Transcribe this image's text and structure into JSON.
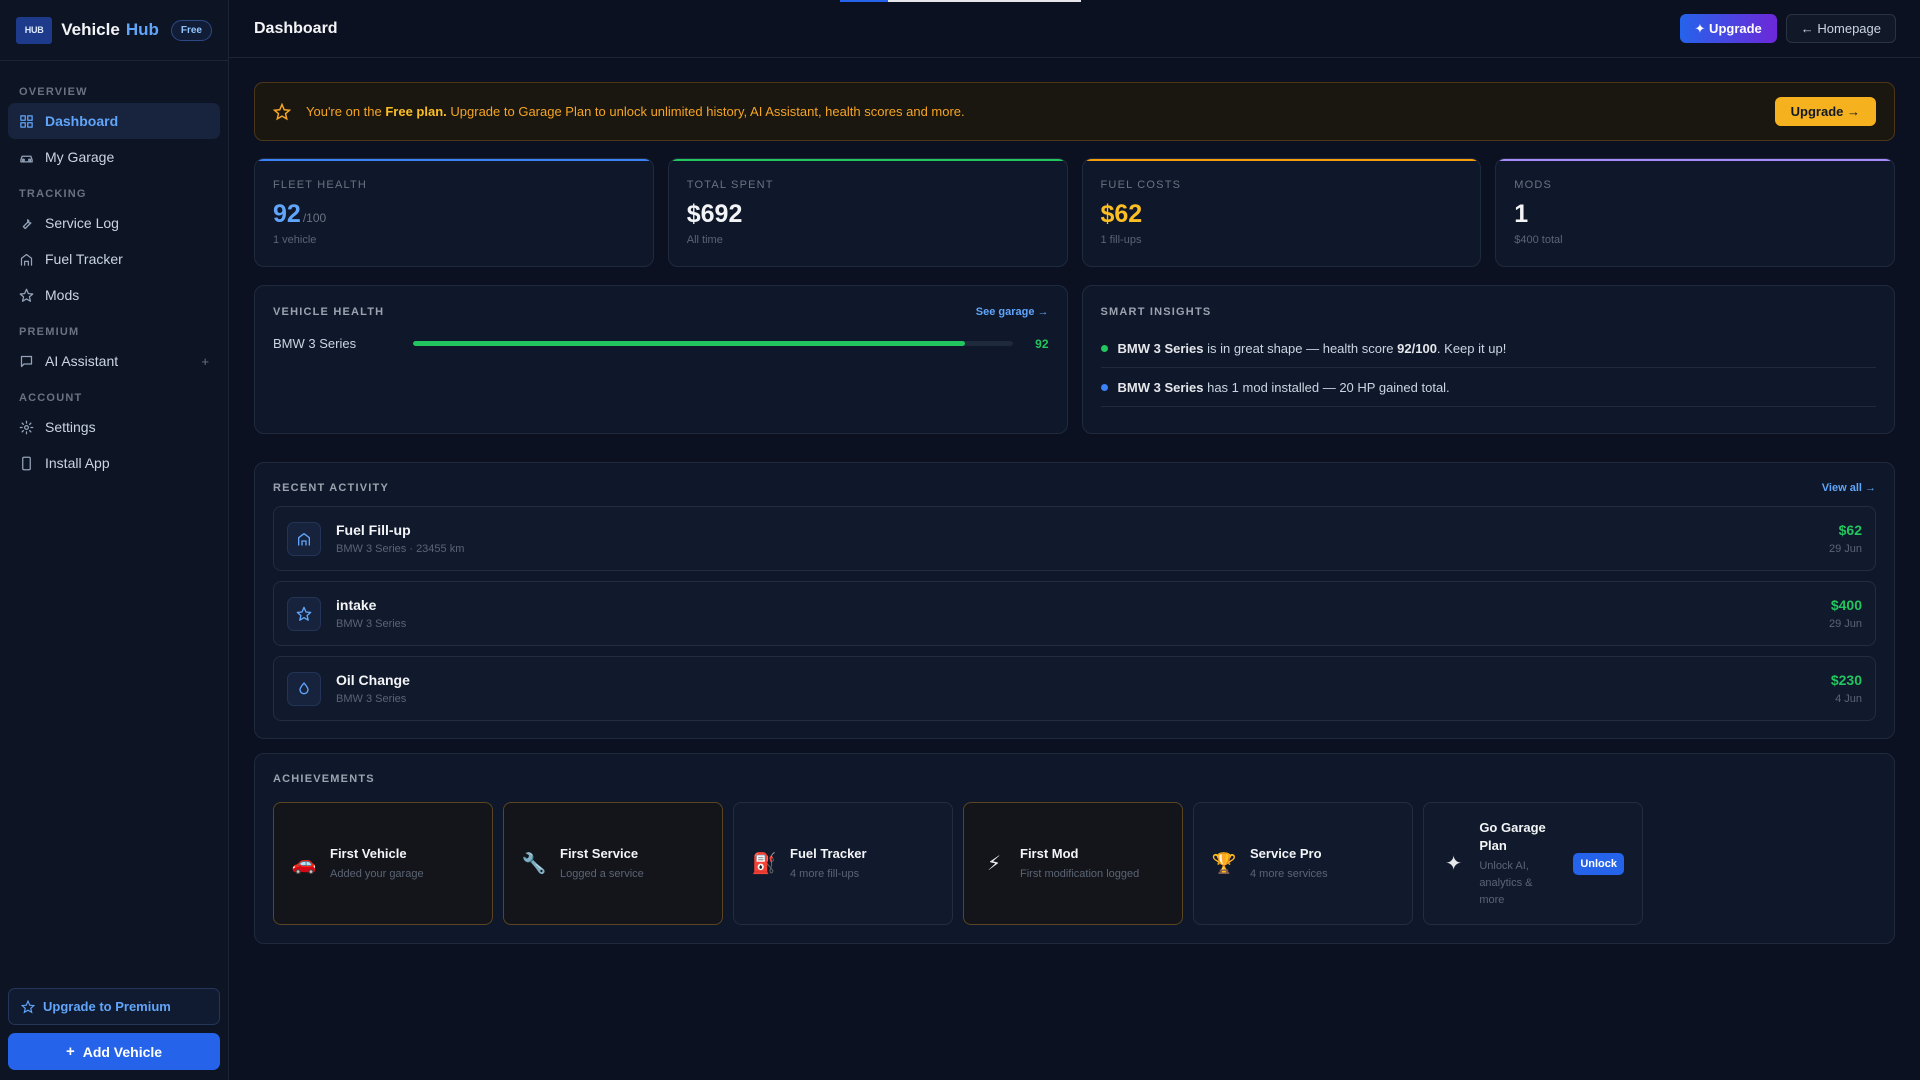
{
  "sidebar": {
    "logo_text": "HUB",
    "brand_name": "Vehicle",
    "brand_accent": "Hub",
    "plan_badge": "Free",
    "sections": [
      {
        "label": "OVERVIEW",
        "items": [
          {
            "label": "Dashboard",
            "icon": "grid-icon",
            "active": true
          },
          {
            "label": "My Garage",
            "icon": "car-icon"
          }
        ]
      },
      {
        "label": "TRACKING",
        "items": [
          {
            "label": "Service Log",
            "icon": "wrench-icon"
          },
          {
            "label": "Fuel Tracker",
            "icon": "fuel-icon"
          },
          {
            "label": "Mods",
            "icon": "star-icon"
          }
        ]
      },
      {
        "label": "PREMIUM",
        "items": [
          {
            "label": "AI Assistant",
            "icon": "chat-icon",
            "badge": "+"
          }
        ]
      },
      {
        "label": "ACCOUNT",
        "items": [
          {
            "label": "Settings",
            "icon": "gear-icon"
          },
          {
            "label": "Install App",
            "icon": "phone-icon"
          }
        ]
      }
    ],
    "upgrade_premium": "Upgrade to Premium",
    "add_vehicle": "Add Vehicle"
  },
  "header": {
    "title": "Dashboard",
    "upgrade_label": "✦ Upgrade",
    "homepage_label": "← Homepage"
  },
  "banner": {
    "prefix": "You're on the ",
    "plan": "Free plan.",
    "text": " Upgrade to Garage Plan to unlock unlimited history, AI Assistant, health scores and more.",
    "button": "Upgrade →"
  },
  "stats": [
    {
      "label": "FLEET HEALTH",
      "value": "92",
      "suffix": "/100",
      "sub": "1 vehicle",
      "accent": "#3b82f6",
      "value_color": "#60a5fa"
    },
    {
      "label": "TOTAL SPENT",
      "value": "$692",
      "suffix": "",
      "sub": "All time",
      "accent": "#22c55e",
      "value_color": "#f3f4f6"
    },
    {
      "label": "FUEL COSTS",
      "value": "$62",
      "suffix": "",
      "sub": "1 fill-ups",
      "accent": "#f59e0b",
      "value_color": "#fbbf24"
    },
    {
      "label": "MODS",
      "value": "1",
      "suffix": "",
      "sub": "$400 total",
      "accent": "#a78bfa",
      "value_color": "#f3f4f6"
    }
  ],
  "vehicle_health": {
    "title": "VEHICLE HEALTH",
    "link": "See garage →",
    "vehicles": [
      {
        "name": "BMW 3 Series",
        "score": 92
      }
    ]
  },
  "insights": {
    "title": "SMART INSIGHTS",
    "items": [
      {
        "dot": "#22c55e",
        "strong": "BMW 3 Series",
        "text_a": " is in great shape — health score ",
        "strong2": "92/100",
        "text_b": ". Keep it up!"
      },
      {
        "dot": "#3b82f6",
        "strong": "BMW 3 Series",
        "text_a": " has 1 mod installed — 20 HP gained total.",
        "strong2": "",
        "text_b": ""
      }
    ]
  },
  "activity": {
    "title": "RECENT ACTIVITY",
    "link": "View all →",
    "rows": [
      {
        "title": "Fuel Fill-up",
        "sub": "BMW 3 Series · 23455 km",
        "amount": "$62",
        "date": "29 Jun",
        "icon": "fuel-icon"
      },
      {
        "title": "intake",
        "sub": "BMW 3 Series",
        "amount": "$400",
        "date": "29 Jun",
        "icon": "star-icon"
      },
      {
        "title": "Oil Change",
        "sub": "BMW 3 Series",
        "amount": "$230",
        "date": "4 Jun",
        "icon": "oil-drop-icon"
      }
    ]
  },
  "achievements": {
    "title": "ACHIEVEMENTS",
    "items": [
      {
        "emoji": "🚗",
        "icon": "car-icon",
        "title": "First Vehicle",
        "sub": "Added your garage",
        "earned": true
      },
      {
        "emoji": "🔧",
        "icon": "wrench-icon",
        "title": "First Service",
        "sub": "Logged a service",
        "earned": true
      },
      {
        "emoji": "⛽",
        "icon": "fuel-pump-icon",
        "title": "Fuel Tracker",
        "sub": "4 more fill-ups",
        "earned": false
      },
      {
        "emoji": "⚡",
        "icon": "lightning-icon",
        "title": "First Mod",
        "sub": "First modification logged",
        "earned": true
      },
      {
        "emoji": "🏆",
        "icon": "trophy-icon",
        "title": "Service Pro",
        "sub": "4 more services",
        "earned": false
      },
      {
        "emoji": "✦",
        "icon": "sparkle-icon",
        "title": "Go Garage Plan",
        "sub": "Unlock AI, analytics & more",
        "earned": false,
        "button": "Unlock"
      }
    ]
  }
}
